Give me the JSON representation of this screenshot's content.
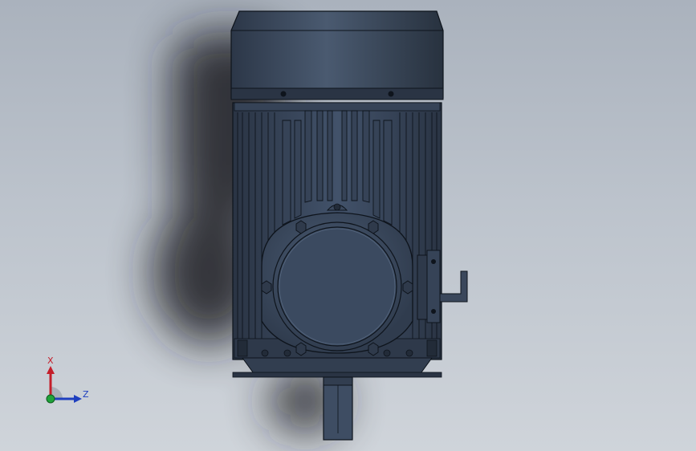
{
  "viewport": {
    "background_top": "#aab2bd",
    "background_bottom": "#cfd4da"
  },
  "model": {
    "body_color": "#3c4a5e",
    "edge_color": "#0e141c",
    "shadow_color": "#1a1e24"
  },
  "triad": {
    "x_label": "X",
    "z_label": "Z",
    "x_color": "#c41e2a",
    "y_color": "#1fa33a",
    "z_color": "#1e3fbf"
  }
}
